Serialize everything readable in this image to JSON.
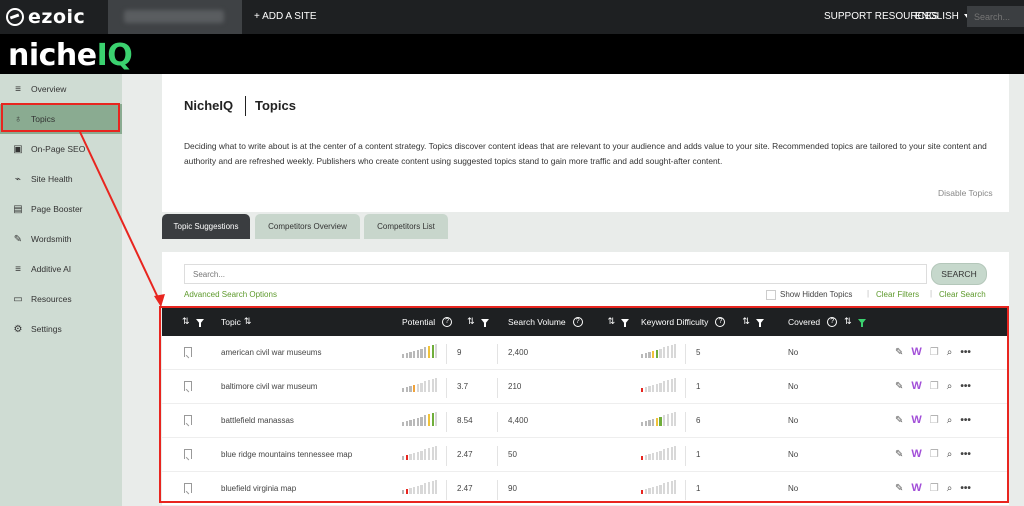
{
  "header": {
    "logo_text": "ezoic",
    "add_site": "+ ADD A SITE",
    "support": "SUPPORT RESOURCES",
    "language": "ENGLISH",
    "search_placeholder": "Search..."
  },
  "brand": {
    "part1": "niche",
    "part2": "IQ"
  },
  "sidebar": {
    "items": [
      {
        "label": "Overview",
        "icon": "overview-icon",
        "glyph": "≡"
      },
      {
        "label": "Topics",
        "icon": "lightbulb-icon",
        "glyph": "♁"
      },
      {
        "label": "On-Page SEO",
        "icon": "page-search-icon",
        "glyph": "▣"
      },
      {
        "label": "Site Health",
        "icon": "pulse-icon",
        "glyph": "⌁"
      },
      {
        "label": "Page Booster",
        "icon": "page-up-icon",
        "glyph": "▤"
      },
      {
        "label": "Wordsmith",
        "icon": "pen-icon",
        "glyph": "✎"
      },
      {
        "label": "Additive AI",
        "icon": "add-list-icon",
        "glyph": "≡"
      },
      {
        "label": "Resources",
        "icon": "folder-icon",
        "glyph": "▭"
      },
      {
        "label": "Settings",
        "icon": "gear-icon",
        "glyph": "⚙"
      }
    ],
    "active_index": 1
  },
  "page": {
    "crumb_parent": "NicheIQ",
    "crumb_current": "Topics",
    "description": "Deciding what to write about is at the center of a content strategy. Topics discover content ideas that are relevant to your audience and adds value to your site. Recommended topics are tailored to your site content and authority and are refreshed weekly. Publishers who create content using suggested topics stand to gain more traffic and add sought-after content.",
    "disable_link": "Disable Topics"
  },
  "tabs": [
    "Topic Suggestions",
    "Competitors Overview",
    "Competitors List"
  ],
  "search": {
    "placeholder": "Search...",
    "button": "SEARCH",
    "advanced": "Advanced Search Options",
    "show_hidden": "Show Hidden Topics",
    "clear_filters": "Clear Filters",
    "clear_search": "Clear Search"
  },
  "table": {
    "columns": [
      "Topic",
      "Potential",
      "Search Volume",
      "Keyword Difficulty",
      "Covered"
    ],
    "rows": [
      {
        "topic": "american civil war museums",
        "potential": "9",
        "potential_level": 9,
        "volume": "2,400",
        "difficulty": "5",
        "difficulty_level": 5,
        "covered": "No"
      },
      {
        "topic": "baltimore civil war museum",
        "potential": "3.7",
        "potential_level": 4,
        "volume": "210",
        "difficulty": "1",
        "difficulty_level": 1,
        "covered": "No"
      },
      {
        "topic": "battlefield manassas",
        "potential": "8.54",
        "potential_level": 9,
        "volume": "4,400",
        "difficulty": "6",
        "difficulty_level": 6,
        "covered": "No"
      },
      {
        "topic": "blue ridge mountains tennessee map",
        "potential": "2.47",
        "potential_level": 2,
        "volume": "50",
        "difficulty": "1",
        "difficulty_level": 1,
        "covered": "No"
      },
      {
        "topic": "bluefield virginia map",
        "potential": "2.47",
        "potential_level": 2,
        "volume": "90",
        "difficulty": "1",
        "difficulty_level": 1,
        "covered": "No"
      }
    ]
  },
  "colors": {
    "accent_green": "#3bd16f",
    "highlight_red": "#e8251f",
    "link_green": "#5e9a2c",
    "wordsmith_purple": "#a24fd8"
  }
}
